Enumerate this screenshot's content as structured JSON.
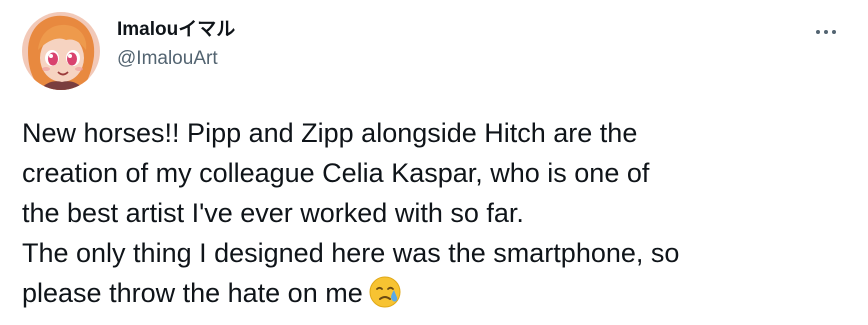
{
  "tweet": {
    "author": {
      "display_name": "Imalouイマル",
      "handle": "@ImalouArt",
      "avatar_icon": "anime-girl-avatar-icon"
    },
    "more_icon": "ellipsis-icon",
    "text_lines": [
      "New horses!! Pipp and Zipp alongside Hitch are the",
      "creation of my colleague Celia Kaspar, who is one of",
      "the best artist I've ever worked with so far.",
      "The only thing I designed here was the smartphone, so",
      "please throw the hate on me"
    ],
    "emoji": "downcast-face-with-sweat-emoji"
  },
  "colors": {
    "text_primary": "#0f1419",
    "text_secondary": "#536471",
    "background": "#ffffff",
    "emoji_yellow": "#f7c332",
    "sweat_blue": "#5aa9e6"
  }
}
